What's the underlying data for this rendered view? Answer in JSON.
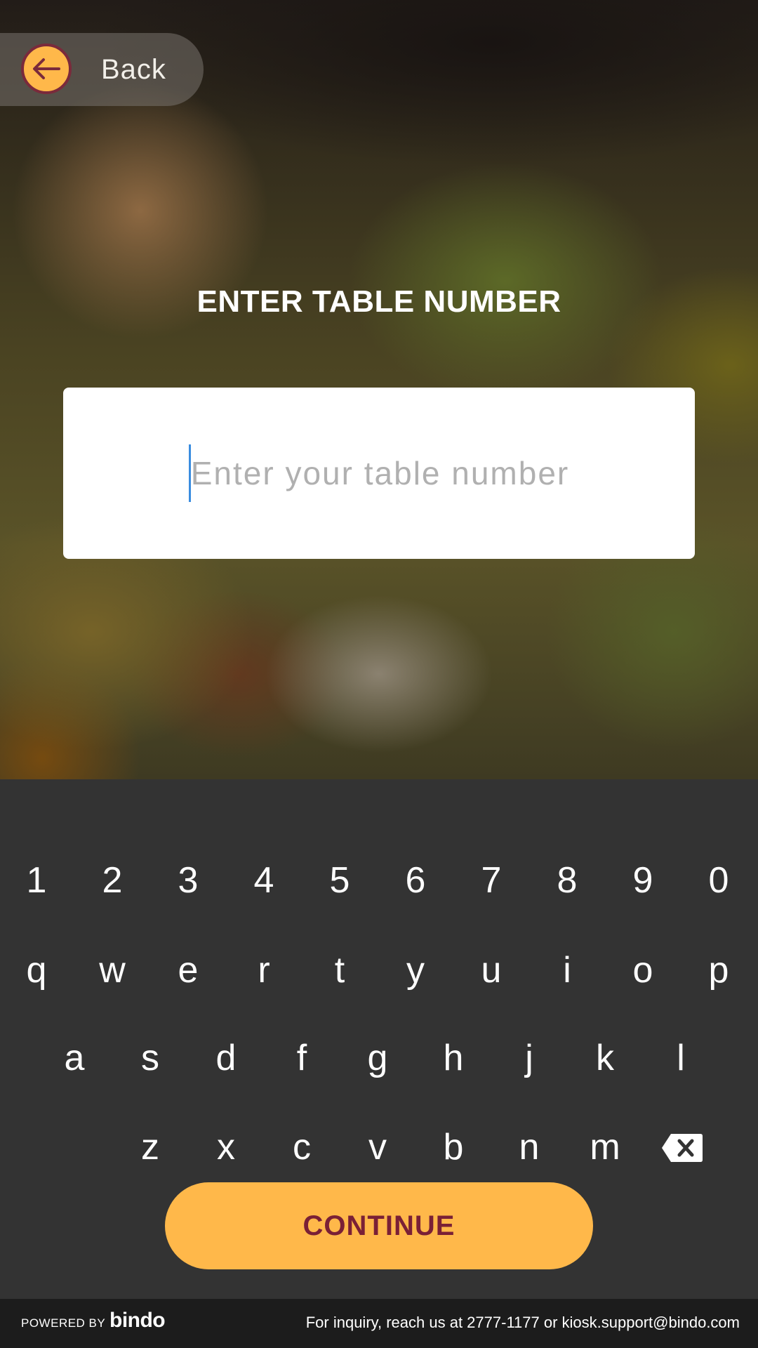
{
  "nav": {
    "back_label": "Back",
    "back_icon": "arrow-left-icon"
  },
  "screen": {
    "title": "ENTER TABLE NUMBER",
    "input_placeholder": "Enter your table number",
    "input_value": ""
  },
  "keyboard": {
    "row_numbers": [
      "1",
      "2",
      "3",
      "4",
      "5",
      "6",
      "7",
      "8",
      "9",
      "0"
    ],
    "row_top": [
      "q",
      "w",
      "e",
      "r",
      "t",
      "y",
      "u",
      "i",
      "o",
      "p"
    ],
    "row_middle": [
      "a",
      "s",
      "d",
      "f",
      "g",
      "h",
      "j",
      "k",
      "l"
    ],
    "row_bottom": [
      "z",
      "x",
      "c",
      "v",
      "b",
      "n",
      "m"
    ],
    "backspace_icon": "backspace-icon"
  },
  "actions": {
    "continue_label": "CONTINUE"
  },
  "footer": {
    "powered_by": "POWERED BY",
    "brand": "bindo",
    "inquiry": "For inquiry, reach us at 2777-1177 or  kiosk.support@bindo.com"
  },
  "colors": {
    "accent": "#ffb84a",
    "accent_text": "#7a2036",
    "keyboard_bg": "#333333",
    "footer_bg": "#1c1c1c",
    "caret": "#3a8de0"
  }
}
